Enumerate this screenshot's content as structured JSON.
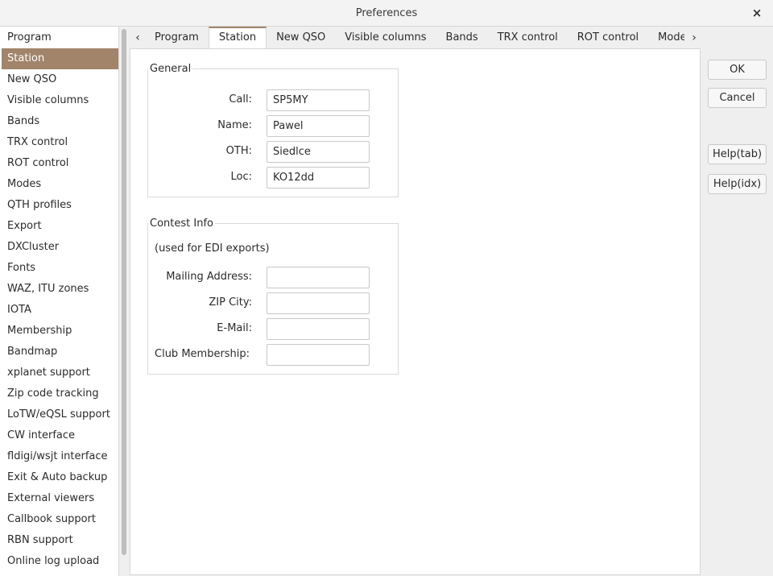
{
  "window": {
    "title": "Preferences",
    "close_glyph": "×"
  },
  "sidebar": {
    "selected_index": 1,
    "items": [
      "Program",
      "Station",
      "New QSO",
      "Visible columns",
      "Bands",
      "TRX control",
      "ROT control",
      "Modes",
      "QTH profiles",
      "Export",
      "DXCluster",
      "Fonts",
      "WAZ, ITU zones",
      "IOTA",
      "Membership",
      "Bandmap",
      "xplanet support",
      "Zip code tracking",
      "LoTW/eQSL support",
      "CW interface",
      "fldigi/wsjt interface",
      "Exit & Auto backup",
      "External viewers",
      "Callbook support",
      "RBN support",
      "Online log upload"
    ]
  },
  "tabs": {
    "left_arrow": "‹",
    "right_arrow": "›",
    "active_index": 1,
    "items": [
      "Program",
      "Station",
      "New QSO",
      "Visible columns",
      "Bands",
      "TRX control",
      "ROT control",
      "Modes"
    ]
  },
  "general": {
    "legend": "General",
    "fields": [
      {
        "label": "Call:",
        "value": "SP5MY"
      },
      {
        "label": "Name:",
        "value": "Pawel"
      },
      {
        "label": "OTH:",
        "value": "Siedlce"
      },
      {
        "label": "Loc:",
        "value": "KO12dd"
      }
    ]
  },
  "contest": {
    "legend": "Contest Info",
    "note": "(used for EDI exports)",
    "fields": [
      {
        "label": "Mailing Address:",
        "value": ""
      },
      {
        "label": "ZIP City:",
        "value": ""
      },
      {
        "label": "E-Mail:",
        "value": ""
      },
      {
        "label": "Club Membership:",
        "value": ""
      }
    ]
  },
  "buttons": {
    "ok": "OK",
    "cancel": "Cancel",
    "help_tab": "Help(tab)",
    "help_idx": "Help(idx)"
  },
  "colors": {
    "accent": "#a1846a"
  }
}
